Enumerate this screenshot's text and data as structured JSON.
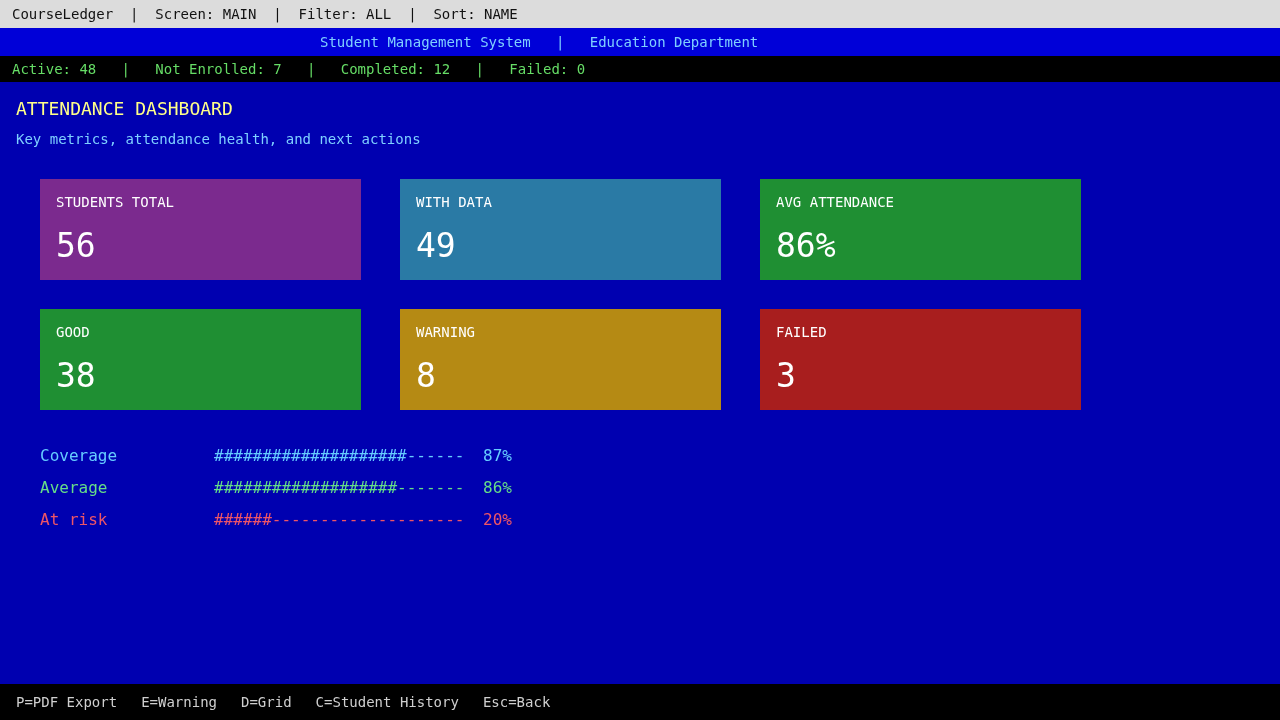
{
  "top_bar": "CourseLedger  |  Screen: MAIN  |  Filter: ALL  |  Sort: NAME",
  "banner": "Student Management System   |   Education Department",
  "status_bar": "Active: 48   |   Not Enrolled: 7   |   Completed: 12   |   Failed: 0",
  "title": "ATTENDANCE DASHBOARD",
  "subtitle": "Key metrics, attendance health, and next actions",
  "cards": [
    {
      "label": "STUDENTS TOTAL",
      "value": "56",
      "color": "#7b2a8e"
    },
    {
      "label": "WITH DATA",
      "value": "49",
      "color": "#2a7aa5"
    },
    {
      "label": "AVG ATTENDANCE",
      "value": "86%",
      "color": "#1f8f33"
    },
    {
      "label": "GOOD",
      "value": "38",
      "color": "#1f8f33"
    },
    {
      "label": "WARNING",
      "value": "8",
      "color": "#b58a14"
    },
    {
      "label": "FAILED",
      "value": "3",
      "color": "#a81e1e"
    }
  ],
  "metrics": [
    {
      "label": "Coverage",
      "bar": "####################------",
      "value": "87%",
      "color": "#66ccff"
    },
    {
      "label": "Average",
      "bar": "###################-------",
      "value": "86%",
      "color": "#66dd88"
    },
    {
      "label": "At risk",
      "bar": "######--------------------",
      "value": "20%",
      "color": "#ee5566"
    }
  ],
  "footer": [
    "P=PDF Export",
    "E=Warning",
    "D=Grid",
    "C=Student History",
    "Esc=Back"
  ]
}
